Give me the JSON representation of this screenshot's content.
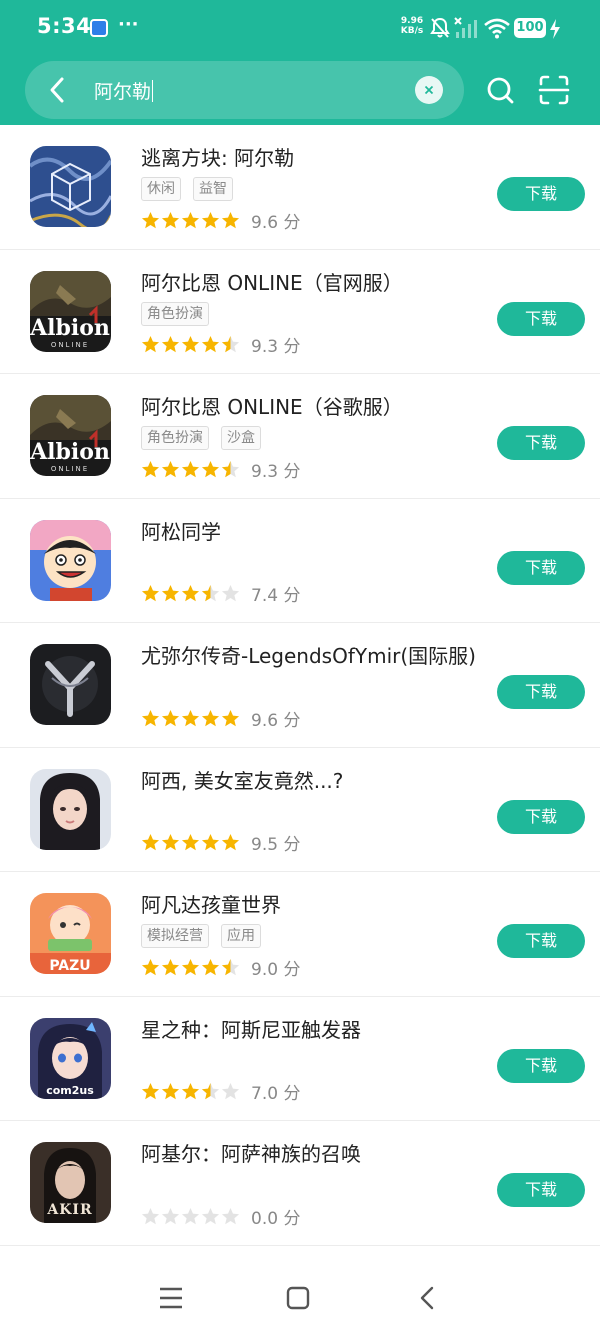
{
  "status": {
    "time": "5:34",
    "dots": "···",
    "net_speed_value": "9.96",
    "net_speed_unit": "KB/s",
    "battery": "100"
  },
  "search": {
    "query": "阿尔勒"
  },
  "buttons": {
    "download": "下载"
  },
  "score_unit": "分",
  "colors": {
    "accent": "#1fb89a",
    "star_on": "#f7b500",
    "star_off": "#e3e3e3"
  },
  "apps": [
    {
      "name": "逃离方块: 阿尔勒",
      "tags": [
        "休闲",
        "益智"
      ],
      "rating": 5,
      "score": "9.6",
      "icon": "rusty-lake-cube-icon"
    },
    {
      "name": "阿尔比恩 ONLINE（官网服）",
      "tags": [
        "角色扮演"
      ],
      "rating": 4.5,
      "score": "9.3",
      "icon": "albion-online-icon"
    },
    {
      "name": "阿尔比恩 ONLINE（谷歌服）",
      "tags": [
        "角色扮演",
        "沙盒"
      ],
      "rating": 4.5,
      "score": "9.3",
      "icon": "albion-online-icon"
    },
    {
      "name": "阿松同学",
      "tags": [],
      "rating": 3.5,
      "score": "7.4",
      "icon": "osomatsu-icon"
    },
    {
      "name": "尤弥尔传奇-LegendsOfYmir(国际服)",
      "tags": [],
      "rating": 5,
      "score": "9.6",
      "icon": "legends-of-ymir-icon"
    },
    {
      "name": "阿西, 美女室友竟然...?",
      "tags": [],
      "rating": 5,
      "score": "9.5",
      "icon": "roommate-girl-icon"
    },
    {
      "name": "阿凡达孩童世界",
      "tags": [
        "模拟经营",
        "应用"
      ],
      "rating": 4.5,
      "score": "9.0",
      "icon": "pazu-avatar-world-icon"
    },
    {
      "name": "星之种：阿斯尼亚触发器",
      "tags": [],
      "rating": 3.5,
      "score": "7.0",
      "icon": "star-seed-com2us-icon"
    },
    {
      "name": "阿基尔：阿萨神族的召唤",
      "tags": [],
      "rating": 0,
      "score": "0.0",
      "icon": "akir-icon"
    }
  ]
}
